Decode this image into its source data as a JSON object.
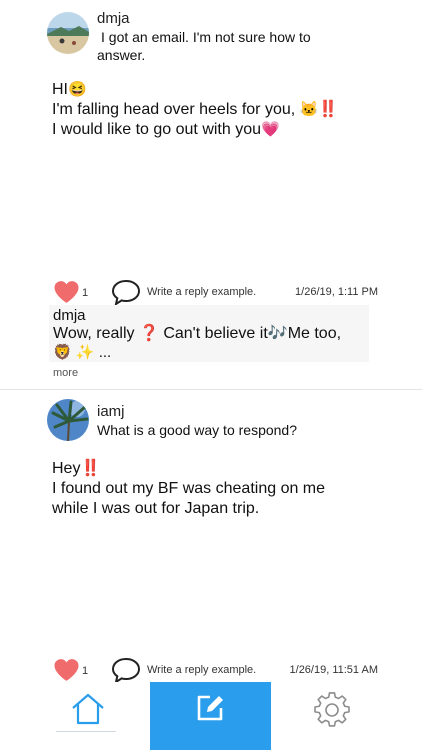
{
  "posts": [
    {
      "username": "dmja",
      "subject": "I got an email. I'm not sure how to answer.",
      "body_lines": [
        {
          "text": "HI",
          "emoji": "😆",
          "trail": ""
        },
        {
          "text": "I'm falling head over heels for you, ",
          "emoji": "🐱",
          "trail": "‼️"
        },
        {
          "text": "I would like to go out with you",
          "emoji": "💗",
          "trail": ""
        }
      ],
      "likes": "1",
      "reply_prompt": "Write a reply example.",
      "timestamp": "1/26/19, 1:11 PM",
      "reply": {
        "username": "dmja",
        "line1_a": "Wow, really ",
        "line1_b": "❓",
        "line1_c": " Can't believe it",
        "line1_d": "🎶",
        "line1_e": "Me too,",
        "line2": "🦁 ✨ ..."
      },
      "more_label": "more"
    },
    {
      "username": "iamj",
      "subject": "What is a good way to respond?",
      "body_lines": [
        {
          "text": "Hey",
          "emoji": "",
          "trail": "‼️"
        },
        {
          "text": "I found out my BF was cheating on me",
          "emoji": "",
          "trail": ""
        },
        {
          "text": "while I was out for Japan trip.",
          "emoji": "",
          "trail": ""
        }
      ],
      "likes": "1",
      "reply_prompt": "Write a reply example.",
      "timestamp": "1/26/19, 11:51 AM"
    }
  ],
  "tabbar": {
    "tabs": [
      {
        "icon": "home-icon",
        "active": true
      },
      {
        "icon": "compose-icon",
        "active": false
      },
      {
        "icon": "gear-icon",
        "active": false
      }
    ],
    "accent": "#2a9eec"
  },
  "colors": {
    "heart": "#f06b6b",
    "accent": "#2a9eec",
    "alert": "#e01919"
  }
}
